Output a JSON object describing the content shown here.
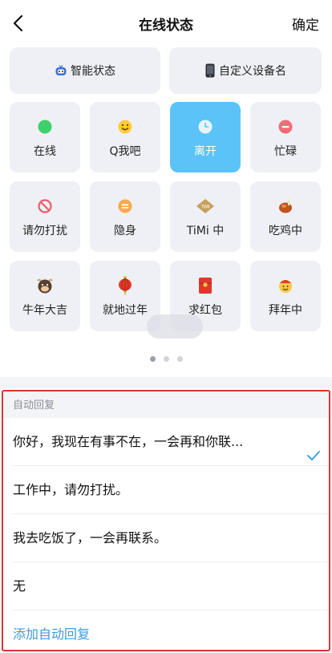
{
  "header": {
    "title": "在线状态",
    "confirm_label": "确定"
  },
  "top_buttons": [
    {
      "label": "智能状态",
      "icon": "robot-tv-icon"
    },
    {
      "label": "自定义设备名",
      "icon": "phone-icon"
    }
  ],
  "status_tiles": [
    {
      "label": "在线",
      "icon": "green-dot-icon"
    },
    {
      "label": "Q我吧",
      "icon": "smile-icon"
    },
    {
      "label": "离开",
      "icon": "clock-icon",
      "selected": true
    },
    {
      "label": "忙碌",
      "icon": "minus-circle-icon"
    },
    {
      "label": "请勿打扰",
      "icon": "no-entry-icon"
    },
    {
      "label": "隐身",
      "icon": "hidden-icon"
    },
    {
      "label": "TiMi 中",
      "icon": "timi-icon"
    },
    {
      "label": "吃鸡中",
      "icon": "chicken-icon"
    },
    {
      "label": "牛年大吉",
      "icon": "ox-icon"
    },
    {
      "label": "就地过年",
      "icon": "lantern-icon"
    },
    {
      "label": "求红包",
      "icon": "red-envelope-icon"
    },
    {
      "label": "拜年中",
      "icon": "greeting-icon"
    }
  ],
  "pager": {
    "pages": 3,
    "current": 1
  },
  "auto_reply": {
    "section_label": "自动回复",
    "items": [
      {
        "text": "你好，我现在有事不在，一会再和你联...",
        "selected": true
      },
      {
        "text": "工作中，请勿打扰。",
        "selected": false
      },
      {
        "text": "我去吃饭了，一会再联系。",
        "selected": false
      },
      {
        "text": "无",
        "selected": false
      }
    ],
    "add_label": "添加自动回复"
  },
  "colors": {
    "accent": "#5bc3f7",
    "tile_bg": "#eef0f5",
    "link": "#3e9bd8",
    "highlight_border": "#d93434"
  }
}
